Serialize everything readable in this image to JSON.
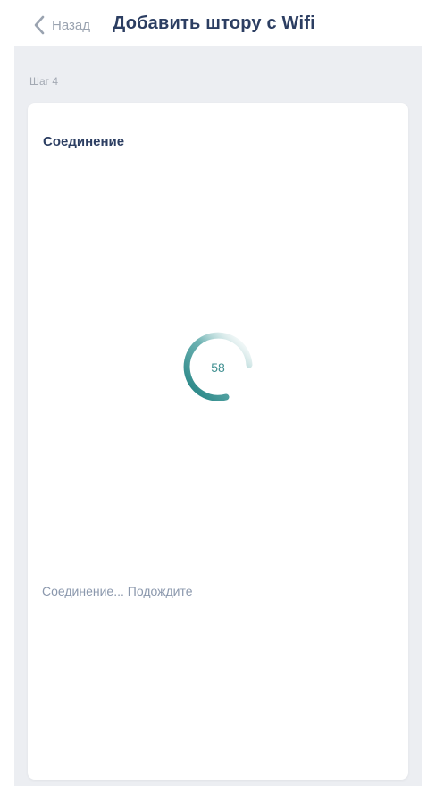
{
  "header": {
    "back_label": "Назад",
    "title": "Добавить штору с Wifi"
  },
  "step": {
    "label": "Шаг 4"
  },
  "card": {
    "title": "Соединение",
    "progress_value": "58",
    "status_text": "Соединение... Подождите"
  },
  "colors": {
    "accent": "#1f8585",
    "title": "#2c3e62",
    "background": "#eceef2"
  },
  "icons": {
    "back": "chevron-left-icon",
    "spinner": "loading-spinner-icon"
  }
}
